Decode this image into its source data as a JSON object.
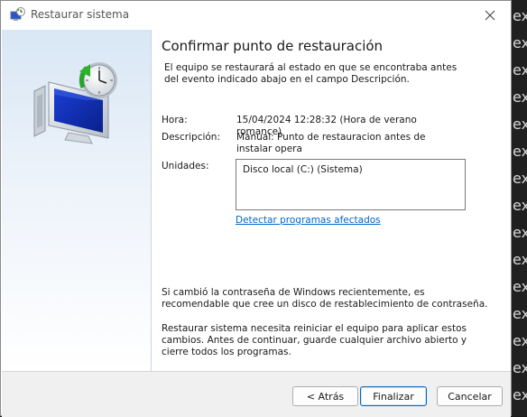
{
  "window": {
    "title": "Restaurar sistema"
  },
  "page": {
    "heading": "Confirmar punto de restauración",
    "intro": "El equipo se restaurará al estado en que se encontraba antes del evento indicado abajo en el campo Descripción.",
    "time_label": "Hora:",
    "time_value": "15/04/2024 12:28:32 (Hora de verano romance)",
    "description_label": "Descripción:",
    "description_value": "Manual: Punto de restauracion antes de instalar opera",
    "drives_label": "Unidades:",
    "drives": [
      "Disco local (C:) (Sistema)"
    ],
    "detect_link": "Detectar programas afectados",
    "password_note": "Si cambió la contraseña de Windows recientemente, es recomendable que cree un disco de restablecimiento de contraseña.",
    "restart_note": "Restaurar sistema necesita reiniciar el equipo para aplicar estos cambios. Antes de continuar, guarde cualquier archivo abierto y cierre todos los programas."
  },
  "buttons": {
    "back": "< Atrás",
    "finish": "Finalizar",
    "cancel": "Cancelar"
  },
  "background_letters": [
    "ex",
    "ex",
    "ex",
    "ex",
    "ex",
    "ex",
    "ex",
    "ex",
    "ex",
    "ex",
    "ex",
    "ex",
    "ex",
    "ex",
    "ex"
  ],
  "icons": {
    "title": "system-restore-icon",
    "close": "close-icon",
    "sidebar": "computer-restore-clock-icon"
  },
  "colors": {
    "link": "#0066cc",
    "sidebar_top": "#d9e7f5",
    "default_button_border": "#0067c0"
  }
}
